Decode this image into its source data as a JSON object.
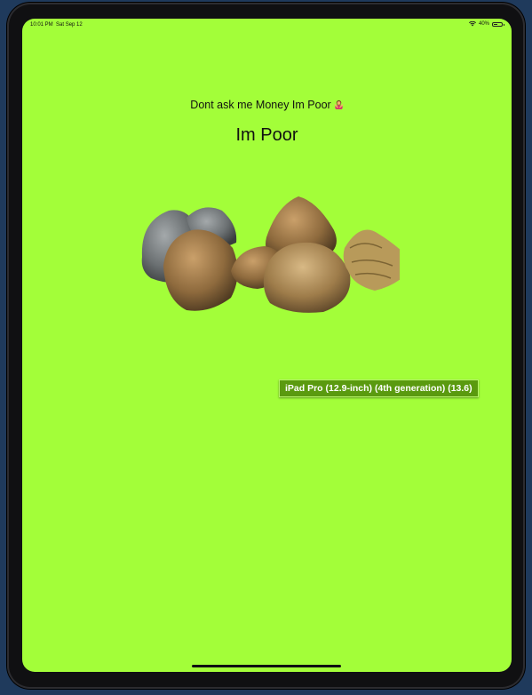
{
  "status_bar": {
    "time": "10:01 PM",
    "date": "Sat Sep 12",
    "battery": "40%",
    "battery_level": 0.4
  },
  "content": {
    "subtitle": "Dont ask me Money Im Poor",
    "title": "Im Poor"
  },
  "simulator": {
    "device_label": "iPad Pro (12.9-inch) (4th generation) (13.6)"
  },
  "colors": {
    "screen_background": "#a3fe39",
    "tooltip_background": "#5a9a0f"
  }
}
